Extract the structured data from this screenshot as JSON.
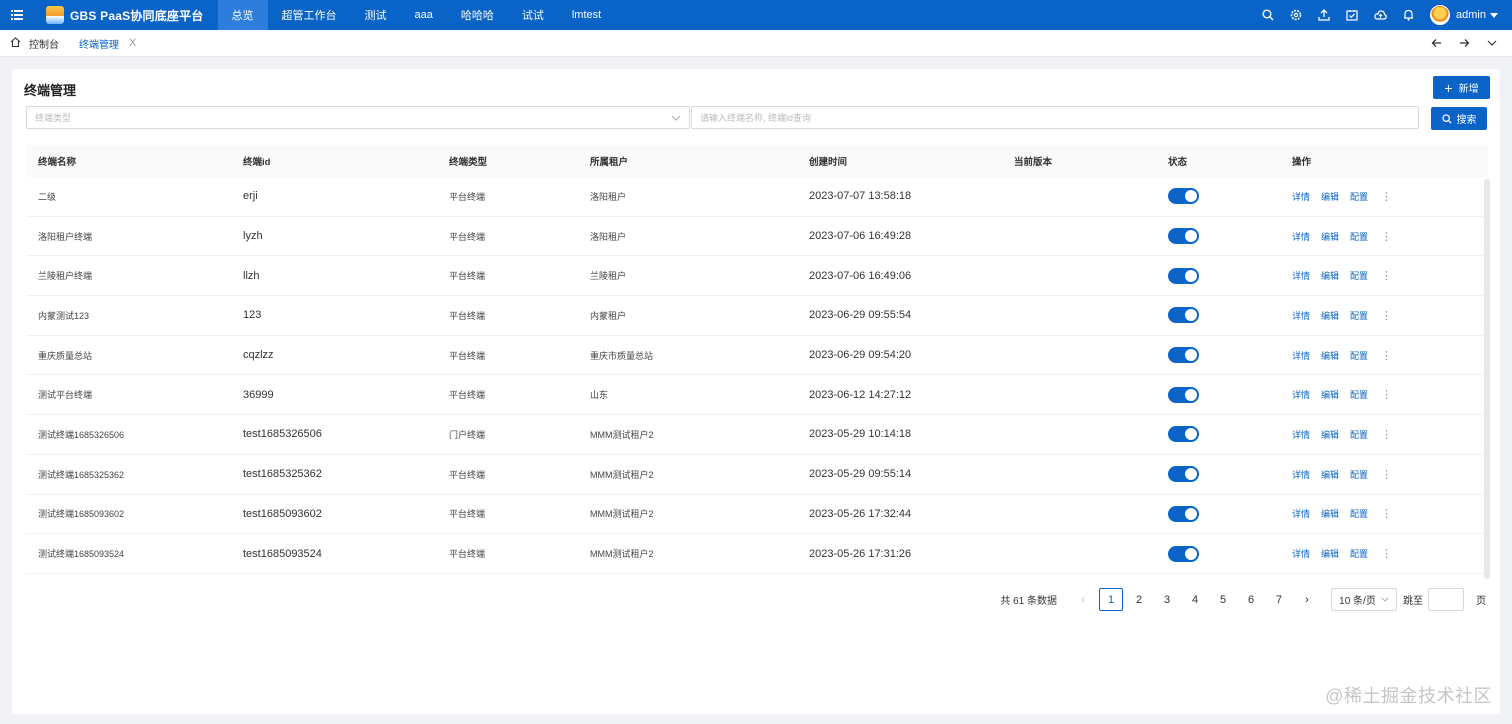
{
  "topbar": {
    "app_title": "GBS PaaS协同底座平台",
    "nav_items": [
      "总览",
      "超管工作台",
      "测试",
      "aaa",
      "哈哈哈",
      "试试",
      "lmtest"
    ],
    "active_nav": "总览",
    "username": "admin"
  },
  "tabs": [
    {
      "label": "控制台",
      "active": false
    },
    {
      "label": "终端管理",
      "active": true,
      "close": "X"
    }
  ],
  "page": {
    "title": "终端管理",
    "add_label": "新增",
    "type_select_placeholder": "终端类型",
    "search_placeholder": "请输入终端名称, 终端id查询",
    "search_label": "搜索"
  },
  "table": {
    "columns": [
      "终端名称",
      "终端id",
      "终端类型",
      "所属租户",
      "创建时间",
      "当前版本",
      "状态",
      "操作"
    ],
    "actions": [
      "详情",
      "编辑",
      "配置"
    ],
    "rows": [
      {
        "name": "二级",
        "id": "erji",
        "type": "平台终端",
        "tenant": "洛阳租户",
        "created": "2023-07-07 13:58:18",
        "version": "",
        "enabled": true
      },
      {
        "name": "洛阳租户终端",
        "id": "lyzh",
        "type": "平台终端",
        "tenant": "洛阳租户",
        "created": "2023-07-06 16:49:28",
        "version": "",
        "enabled": true
      },
      {
        "name": "兰陵租户终端",
        "id": "llzh",
        "type": "平台终端",
        "tenant": "兰陵租户",
        "created": "2023-07-06 16:49:06",
        "version": "",
        "enabled": true
      },
      {
        "name": "内蒙测试123",
        "id": "123",
        "type": "平台终端",
        "tenant": "内蒙租户",
        "created": "2023-06-29 09:55:54",
        "version": "",
        "enabled": true
      },
      {
        "name": "重庆质量总站",
        "id": "cqzlzz",
        "type": "平台终端",
        "tenant": "重庆市质量总站",
        "created": "2023-06-29 09:54:20",
        "version": "",
        "enabled": true
      },
      {
        "name": "测试平台终端",
        "id": "36999",
        "type": "平台终端",
        "tenant": "山东",
        "created": "2023-06-12 14:27:12",
        "version": "",
        "enabled": true
      },
      {
        "name": "测试终端1685326506",
        "id": "test1685326506",
        "type": "门户终端",
        "tenant": "MMM测试租户2",
        "created": "2023-05-29 10:14:18",
        "version": "",
        "enabled": true
      },
      {
        "name": "测试终端1685325362",
        "id": "test1685325362",
        "type": "平台终端",
        "tenant": "MMM测试租户2",
        "created": "2023-05-29 09:55:14",
        "version": "",
        "enabled": true
      },
      {
        "name": "测试终端1685093602",
        "id": "test1685093602",
        "type": "平台终端",
        "tenant": "MMM测试租户2",
        "created": "2023-05-26 17:32:44",
        "version": "",
        "enabled": true
      },
      {
        "name": "测试终端1685093524",
        "id": "test1685093524",
        "type": "平台终端",
        "tenant": "MMM测试租户2",
        "created": "2023-05-26 17:31:26",
        "version": "",
        "enabled": true
      }
    ]
  },
  "pagination": {
    "total_text": "共 61 条数据",
    "pages": [
      "1",
      "2",
      "3",
      "4",
      "5",
      "6",
      "7"
    ],
    "current": "1",
    "page_size": "10 条/页",
    "jump_label": "跳至",
    "jump_unit": "页"
  },
  "watermark": "@稀土掘金技术社区",
  "colors": {
    "primary": "#0a64c8",
    "topbar": "#0a64c8"
  }
}
